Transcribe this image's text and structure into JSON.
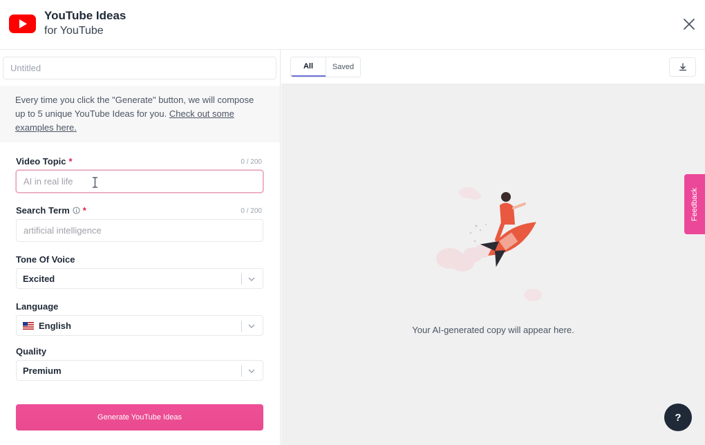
{
  "header": {
    "title": "YouTube Ideas",
    "subtitle": "for YouTube",
    "logo_icon": "youtube-logo-icon",
    "close_icon": "close-icon"
  },
  "document": {
    "title_placeholder": "Untitled"
  },
  "intro": {
    "text": "Every time you click the \"Generate\" button, we will compose up to 5 unique YouTube Ideas for you. ",
    "link": "Check out some examples here."
  },
  "form": {
    "video_topic": {
      "label": "Video Topic",
      "required_mark": "*",
      "counter": "0 / 200",
      "placeholder": "AI in real life"
    },
    "search_term": {
      "label": "Search Term",
      "required_mark": "*",
      "counter": "0 / 200",
      "placeholder": "artificial intelligence",
      "info_icon": "info-icon"
    },
    "tone": {
      "label": "Tone Of Voice",
      "value": "Excited"
    },
    "language": {
      "label": "Language",
      "value": "English",
      "flag_icon": "us-flag-icon"
    },
    "quality": {
      "label": "Quality",
      "value": "Premium"
    },
    "generate_label": "Generate YouTube Ideas"
  },
  "results": {
    "tabs": [
      {
        "label": "All",
        "active": true
      },
      {
        "label": "Saved",
        "active": false
      }
    ],
    "download_icon": "download-icon",
    "empty_message": "Your AI-generated copy will appear here."
  },
  "widgets": {
    "feedback_label": "Feedback",
    "help_label": "?"
  },
  "colors": {
    "accent": "#ec4899",
    "youtube_red": "#ff0000",
    "tab_indicator": "#6b6fd4",
    "help_bg": "#1f2937"
  }
}
